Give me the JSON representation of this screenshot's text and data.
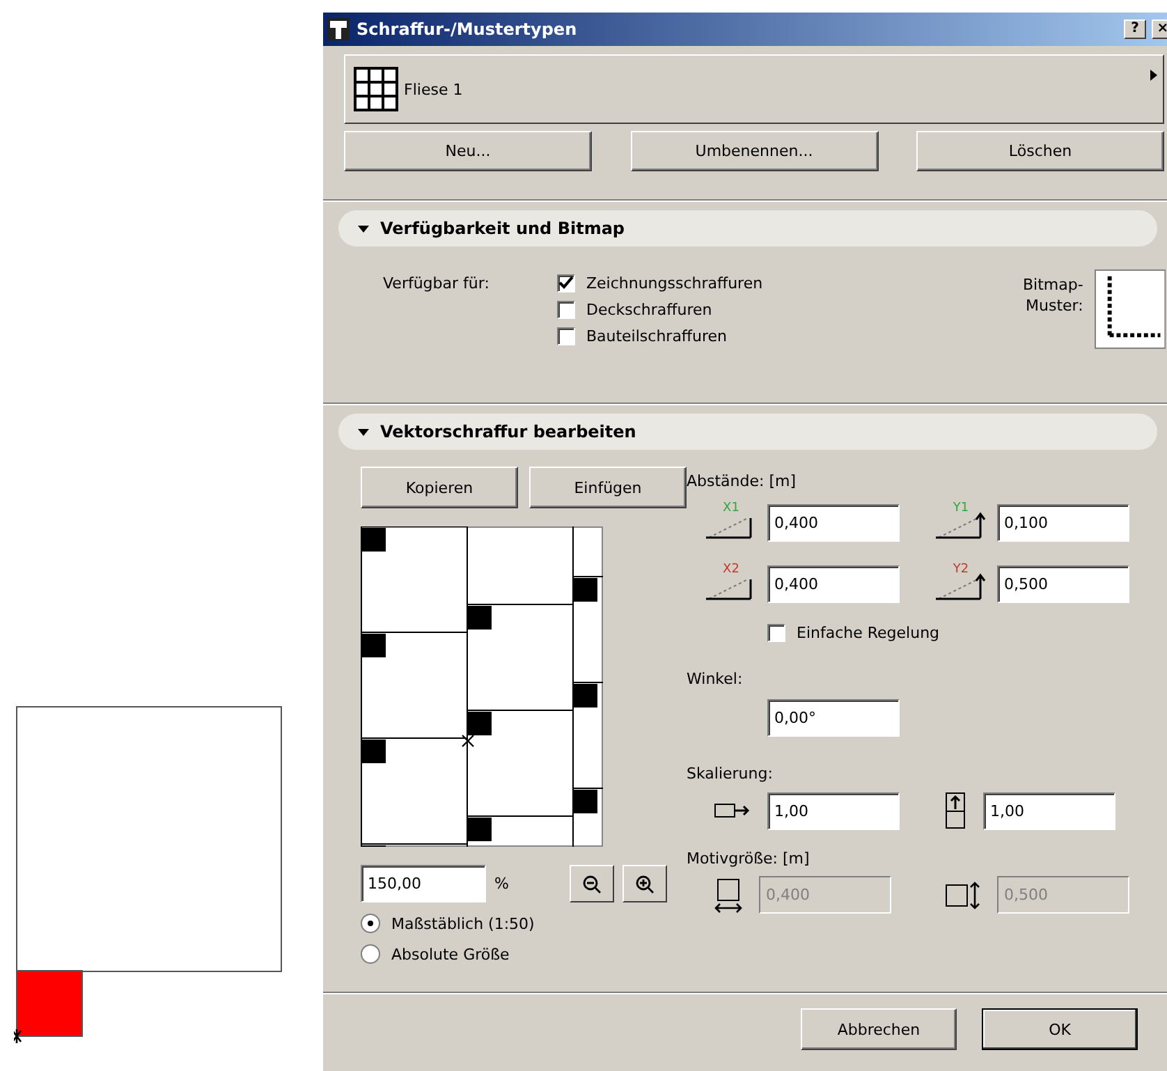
{
  "window": {
    "title": "Schraffur-/Mustertypen",
    "help": "?",
    "close": "×"
  },
  "pattern_selector": {
    "name": "Fliese 1"
  },
  "buttons": [
    "Neu...",
    "Umbenennen...",
    "Löschen"
  ],
  "availability": {
    "title": "Verfügbarkeit und Bitmap",
    "expanded": true,
    "label": "Verfügbar für:",
    "options": [
      {
        "label": "Zeichnungsschraffuren",
        "checked": true
      },
      {
        "label": "Deckschraffuren",
        "checked": false
      },
      {
        "label": "Bauteilschraffuren",
        "checked": false
      }
    ],
    "bitmap_label": [
      "Bitmap-",
      "Muster:"
    ]
  },
  "vector": {
    "title": "Vektorschraffur bearbeiten",
    "expanded": true,
    "edit_buttons": [
      "Kopieren",
      "Einfügen"
    ],
    "zoom": {
      "value": "150,00",
      "unit": "%"
    },
    "scale_modes": [
      {
        "label": "Maßstäblich (1:50)",
        "selected": true
      },
      {
        "label": "Absolute Größe",
        "selected": false
      }
    ],
    "spacing_label": "Abstände: [m]",
    "spacing": [
      {
        "axis": "X1",
        "color": "#2fa83a",
        "value": "0,400"
      },
      {
        "axis": "Y1",
        "color": "#2fa83a",
        "value": "0,100"
      },
      {
        "axis": "X2",
        "color": "#c0392b",
        "value": "0,400"
      },
      {
        "axis": "Y2",
        "color": "#c0392b",
        "value": "0,500"
      }
    ],
    "simple_control": {
      "label": "Einfache Regelung",
      "checked": false
    },
    "angle_label": "Winkel:",
    "angle": "0,00°",
    "scaling_label": "Skalierung:",
    "scaling": [
      "1,00",
      "1,00"
    ],
    "motif_label": "Motivgröße: [m]",
    "motif": [
      "0,400",
      "0,500"
    ]
  },
  "footer_buttons": [
    "Abbrechen",
    "OK"
  ]
}
